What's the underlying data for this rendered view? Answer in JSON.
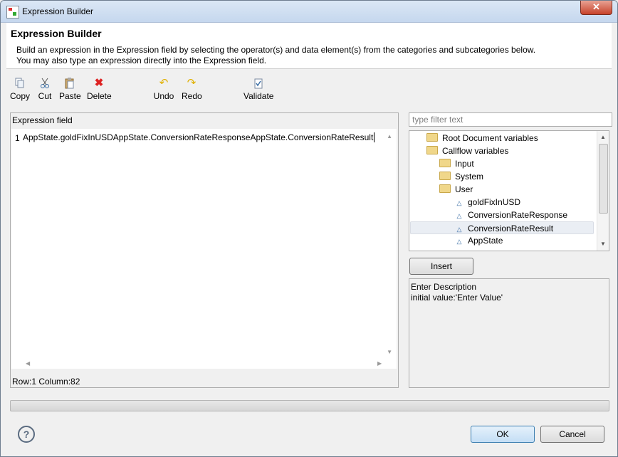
{
  "window": {
    "title": "Expression Builder",
    "close_label": "✕"
  },
  "header": {
    "title": "Expression Builder",
    "desc_line1": "Build an expression in the Expression field by selecting the operator(s) and data element(s) from the categories and subcategories below.",
    "desc_line2": "You may also type an expression directly into the Expression field."
  },
  "toolbar": {
    "copy": "Copy",
    "cut": "Cut",
    "paste": "Paste",
    "delete": "Delete",
    "undo": "Undo",
    "redo": "Redo",
    "validate": "Validate"
  },
  "expression": {
    "label": "Expression field",
    "line_number": "1",
    "text": "AppState.goldFixInUSDAppState.ConversionRateResponseAppState.ConversionRateResult",
    "status": "Row:1 Column:82"
  },
  "filter": {
    "placeholder": "type filter text"
  },
  "tree": {
    "items": [
      {
        "label": "Root Document variables",
        "kind": "folder"
      },
      {
        "label": "Callflow variables",
        "kind": "folder"
      },
      {
        "label": "Input",
        "kind": "folder"
      },
      {
        "label": "System",
        "kind": "folder"
      },
      {
        "label": "User",
        "kind": "folder"
      },
      {
        "label": "goldFixInUSD",
        "kind": "variable"
      },
      {
        "label": "ConversionRateResponse",
        "kind": "variable"
      },
      {
        "label": "ConversionRateResult",
        "kind": "variable",
        "selected": true
      },
      {
        "label": "AppState",
        "kind": "variable"
      }
    ]
  },
  "insert_label": "Insert",
  "description": {
    "line1": "Enter Description",
    "line2": "initial value:'Enter Value'"
  },
  "buttons": {
    "ok": "OK",
    "cancel": "Cancel",
    "help": "?"
  }
}
